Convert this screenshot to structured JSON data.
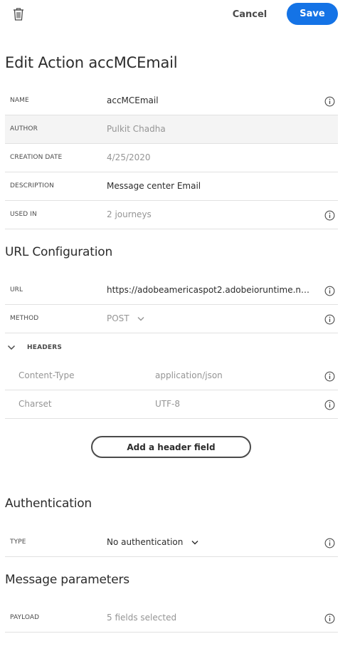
{
  "toolbar": {
    "cancel_label": "Cancel",
    "save_label": "Save"
  },
  "page_title": "Edit Action accMCEmail",
  "details": {
    "name": {
      "label": "NAME",
      "value": "accMCEmail"
    },
    "author": {
      "label": "AUTHOR",
      "value": "Pulkit Chadha"
    },
    "creation_date": {
      "label": "CREATION DATE",
      "value": "4/25/2020"
    },
    "description": {
      "label": "DESCRIPTION",
      "value": "Message center Email"
    },
    "used_in": {
      "label": "USED IN",
      "value": "2 journeys"
    }
  },
  "url_config": {
    "title": "URL Configuration",
    "url": {
      "label": "URL",
      "value": "https://adobeamericaspot2.adobeioruntime.ne..."
    },
    "method": {
      "label": "METHOD",
      "value": "POST"
    },
    "headers_label": "HEADERS",
    "headers": [
      {
        "key": "Content-Type",
        "value": "application/json"
      },
      {
        "key": "Charset",
        "value": "UTF-8"
      }
    ],
    "add_header_label": "Add a header field"
  },
  "authentication": {
    "title": "Authentication",
    "type": {
      "label": "TYPE",
      "value": "No authentication"
    }
  },
  "message_parameters": {
    "title": "Message parameters",
    "payload": {
      "label": "PAYLOAD",
      "value": "5 fields selected"
    }
  },
  "colors": {
    "accent": "#1473e6",
    "text": "#2c2c2c",
    "muted": "#959595",
    "divider": "#e1e1e1",
    "shaded_row": "#f4f4f4"
  },
  "icons": [
    "trash-icon",
    "info-icon",
    "chevron-down-icon"
  ]
}
